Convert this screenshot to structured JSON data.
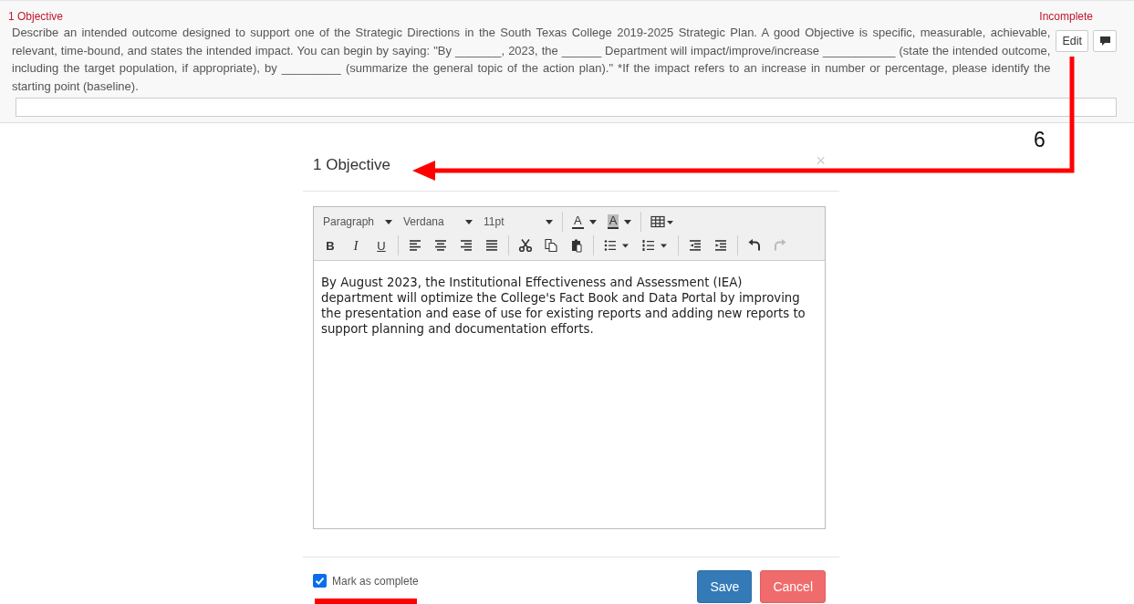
{
  "section": {
    "title": "1 Objective",
    "status": "Incomplete",
    "description": "Describe an intended outcome designed to support one of the Strategic Directions in the South Texas College 2019-2025 Strategic Plan. A good Objective is specific, measurable, achievable, relevant, time-bound, and states the intended impact. You can begin by saying: \"By _______, 2023, the ______ Department will impact/improve/increase ___________ (state the intended outcome, including the target population, if appropriate), by _________ (summarize the general topic of the action plan).\" *If the impact refers to an increase in number or percentage, please identify the starting point (baseline).",
    "edit_button": "Edit"
  },
  "modal": {
    "title": "1 Objective",
    "close": "×",
    "toolbar": [
      [
        [
          {
            "kind": "select",
            "label": "Paragraph",
            "disabled": false
          },
          {
            "kind": "select",
            "label": "Verdana",
            "disabled": false
          },
          {
            "kind": "select",
            "label": "11pt",
            "disabled": false
          }
        ],
        [
          {
            "kind": "text-color",
            "label": "A",
            "disabled": false
          },
          {
            "kind": "highlight-color",
            "label": "A",
            "disabled": false
          }
        ],
        [
          {
            "kind": "table",
            "disabled": false
          }
        ]
      ],
      [
        [
          {
            "kind": "bold",
            "label": "B",
            "disabled": false
          },
          {
            "kind": "italic",
            "label": "I",
            "disabled": false
          },
          {
            "kind": "underline",
            "label": "U",
            "disabled": false
          }
        ],
        [
          {
            "kind": "align-left",
            "disabled": false
          },
          {
            "kind": "align-center",
            "disabled": false
          },
          {
            "kind": "align-right",
            "disabled": false
          },
          {
            "kind": "justify",
            "disabled": false
          }
        ],
        [
          {
            "kind": "cut",
            "disabled": false
          },
          {
            "kind": "copy",
            "disabled": false
          },
          {
            "kind": "paste",
            "disabled": false
          }
        ],
        [
          {
            "kind": "bullet-list",
            "disabled": false
          },
          {
            "kind": "numbered-list",
            "disabled": false
          }
        ],
        [
          {
            "kind": "outdent",
            "disabled": false
          },
          {
            "kind": "indent",
            "disabled": false
          }
        ],
        [
          {
            "kind": "undo",
            "disabled": false
          },
          {
            "kind": "redo",
            "disabled": true
          }
        ]
      ]
    ],
    "content": "By August 2023, the Institutional Effectiveness and Assessment (IEA) department will optimize the College's Fact Book and Data Portal by improving the presentation and ease of use for existing reports and adding new reports to support planning and documentation efforts.",
    "mark_complete": {
      "label": "Mark as complete",
      "checked": true
    },
    "buttons": [
      {
        "kind": "primary",
        "label": "Save"
      },
      {
        "kind": "danger",
        "label": "Cancel"
      }
    ]
  },
  "annotation": {
    "step_number": "6"
  }
}
